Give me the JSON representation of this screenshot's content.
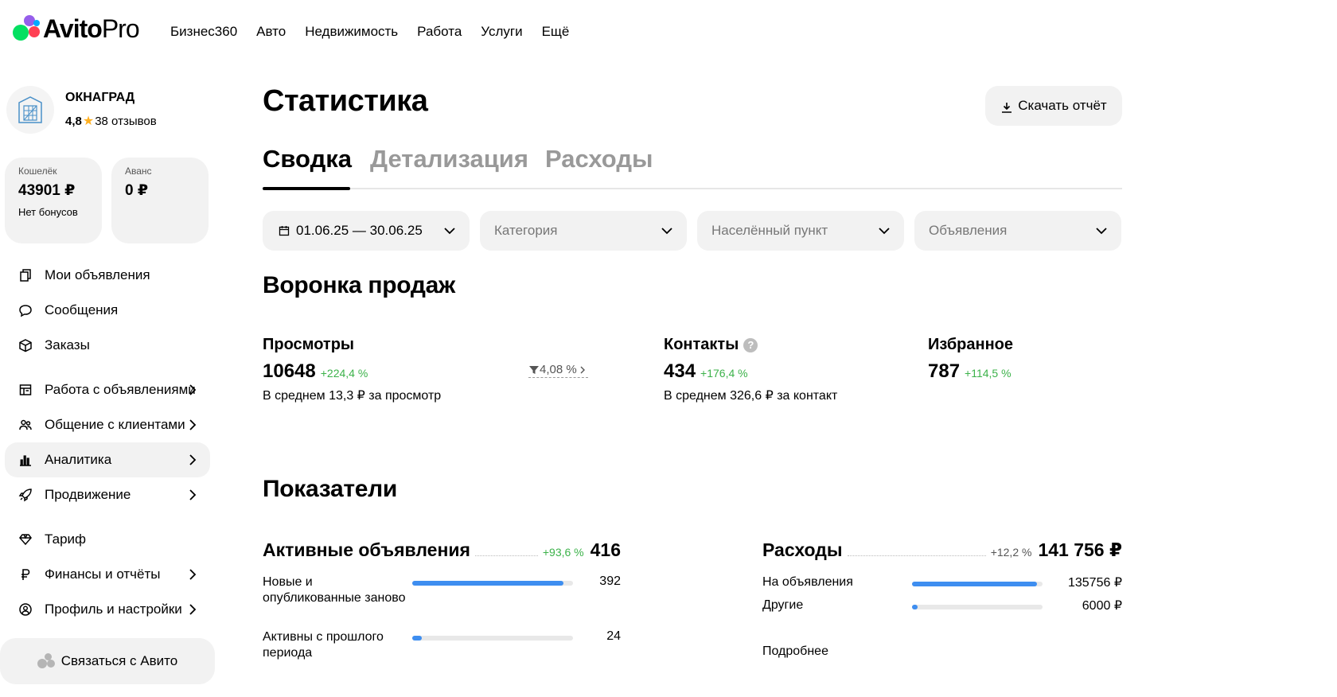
{
  "header": {
    "logo_main": "Avito",
    "logo_pro": "Pro",
    "nav": [
      "Бизнес360",
      "Авто",
      "Недвижимость",
      "Работа",
      "Услуги",
      "Ещё"
    ]
  },
  "profile": {
    "name": "ОКНАГРАД",
    "rating": "4,8",
    "reviews": "38 отзывов"
  },
  "wallet": {
    "label": "Кошелёк",
    "value": "43901 ₽",
    "note": "Нет бонусов"
  },
  "advance": {
    "label": "Аванс",
    "value": "0 ₽"
  },
  "sidebar": {
    "items": [
      {
        "label": "Мои объявления",
        "icon": "listings-icon"
      },
      {
        "label": "Сообщения",
        "icon": "chat-icon"
      },
      {
        "label": "Заказы",
        "icon": "box-icon"
      },
      {
        "label": "Работа с объявлениями",
        "icon": "layout-icon"
      },
      {
        "label": "Общение с клиентами",
        "icon": "users-icon"
      },
      {
        "label": "Аналитика",
        "icon": "bar-chart-icon"
      },
      {
        "label": "Продвижение",
        "icon": "rocket-icon"
      },
      {
        "label": "Тариф",
        "icon": "diamond-icon"
      },
      {
        "label": "Финансы и отчёты",
        "icon": "ruble-icon"
      },
      {
        "label": "Профиль и настройки",
        "icon": "profile-icon"
      }
    ],
    "contact_button": "Связаться с Авито"
  },
  "main": {
    "title": "Статистика",
    "download_button": "Скачать отчёт",
    "tabs": [
      "Сводка",
      "Детализация",
      "Расходы"
    ],
    "filters": {
      "date": "01.06.25 — 30.06.25",
      "category": "Категория",
      "location": "Населённый пункт",
      "listings": "Объявления"
    }
  },
  "funnel": {
    "title": "Воронка продаж",
    "views": {
      "label": "Просмотры",
      "value": "10648",
      "delta": "+224,4 %",
      "note": "В среднем 13,3 ₽ за просмотр",
      "conversion": "4,08 %"
    },
    "contacts": {
      "label": "Контакты",
      "value": "434",
      "delta": "+176,4 %",
      "note": "В среднем 326,6 ₽ за контакт"
    },
    "favorites": {
      "label": "Избранное",
      "value": "787",
      "delta": "+114,5 %"
    }
  },
  "indicators": {
    "title": "Показатели",
    "active": {
      "title": "Активные объявления",
      "delta": "+93,6 %",
      "value": "416",
      "rows": [
        {
          "label": "Новые и опубликованные заново",
          "value": "392",
          "fraction": 0.94
        },
        {
          "label": "Активны с прошлого периода",
          "value": "24",
          "fraction": 0.06
        }
      ]
    },
    "expenses": {
      "title": "Расходы",
      "delta": "+12,2 %",
      "value": "141 756 ₽",
      "rows": [
        {
          "label": "На объявления",
          "value": "135756 ₽",
          "fraction": 0.96
        },
        {
          "label": "Другие",
          "value": "6000 ₽",
          "fraction": 0.04
        }
      ],
      "more": "Подробнее"
    }
  },
  "colors": {
    "positive": "#3cb24a",
    "bar": "#3e8ef0",
    "surface": "#f2f2f2"
  }
}
